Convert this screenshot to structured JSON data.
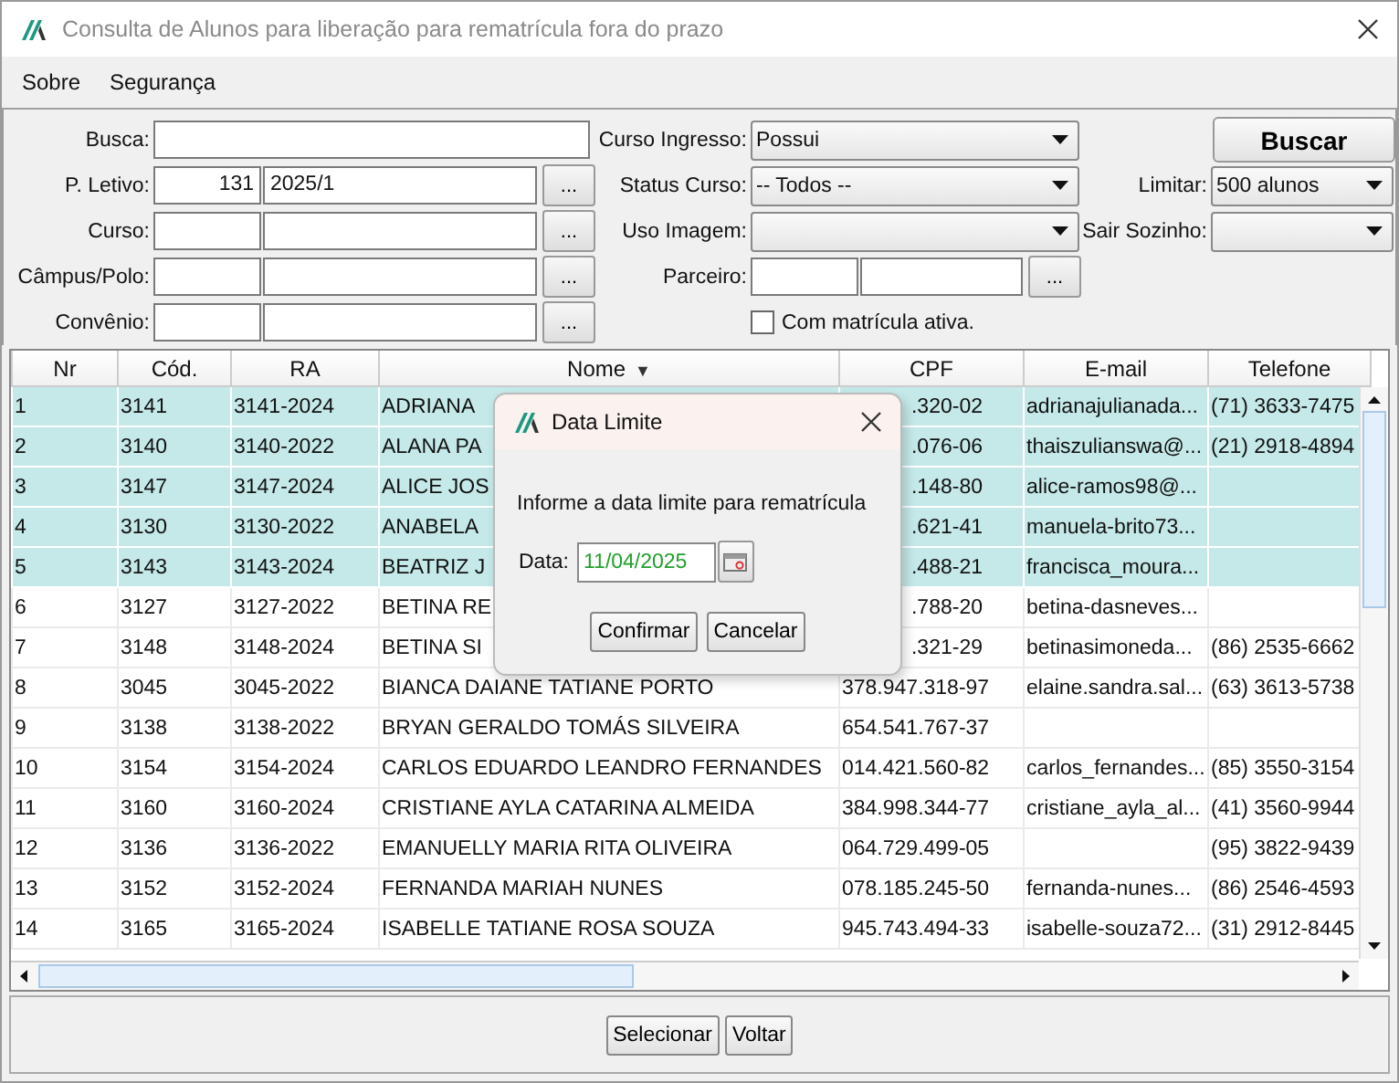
{
  "window": {
    "title": "Consulta de Alunos para liberação para rematrícula fora do prazo"
  },
  "menu": [
    {
      "label": "Sobre"
    },
    {
      "label": "Segurança"
    }
  ],
  "filters": {
    "left": [
      {
        "kind": "text",
        "label": "Busca:"
      },
      {
        "kind": "lookup",
        "label": "P. Letivo:",
        "code": "131",
        "value": "2025/1",
        "button": "..."
      },
      {
        "kind": "lookup",
        "label": "Curso:",
        "button": "..."
      },
      {
        "kind": "lookup",
        "label": "Câmpus/Polo:",
        "button": "..."
      },
      {
        "kind": "lookup",
        "label": "Convênio:",
        "button": "..."
      }
    ],
    "middle": [
      {
        "kind": "select",
        "label": "Curso Ingresso:",
        "value": "Possui"
      },
      {
        "kind": "select",
        "label": "Status Curso:",
        "value": "-- Todos --"
      },
      {
        "kind": "select",
        "label": "Uso Imagem:"
      },
      {
        "kind": "lookup",
        "label": "Parceiro:",
        "button": "..."
      },
      {
        "kind": "checkbox",
        "label": "Com matrícula ativa.",
        "checked": false
      }
    ],
    "right": [
      {
        "kind": "button",
        "label": "Buscar"
      },
      {
        "kind": "select",
        "label": "Limitar:",
        "value": "500 alunos"
      },
      {
        "kind": "select",
        "label": "Sair Sozinho:"
      }
    ]
  },
  "table": {
    "columns": [
      {
        "label": "Nr"
      },
      {
        "label": "Cód."
      },
      {
        "label": "RA"
      },
      {
        "label": "Nome",
        "sort_icon": "▼"
      },
      {
        "label": "CPF"
      },
      {
        "label": "E-mail"
      },
      {
        "label": "Telefone"
      }
    ],
    "rows": [
      {
        "selected": true,
        "covered": true,
        "cells": [
          "1",
          "3141",
          "3141-2024",
          "ADRIANA",
          ".320-02",
          "adrianajulianada...",
          "(71) 3633-7475"
        ]
      },
      {
        "selected": true,
        "covered": true,
        "cells": [
          "2",
          "3140",
          "3140-2022",
          "ALANA PA",
          ".076-06",
          "thaiszulianswa@...",
          "(21) 2918-4894"
        ]
      },
      {
        "selected": true,
        "covered": true,
        "cells": [
          "3",
          "3147",
          "3147-2024",
          "ALICE JOS",
          ".148-80",
          "alice-ramos98@...",
          ""
        ]
      },
      {
        "selected": true,
        "covered": true,
        "cells": [
          "4",
          "3130",
          "3130-2022",
          "ANABELA",
          ".621-41",
          "manuela-brito73...",
          ""
        ]
      },
      {
        "selected": true,
        "covered": true,
        "cells": [
          "5",
          "3143",
          "3143-2024",
          "BEATRIZ J",
          ".488-21",
          "francisca_moura...",
          ""
        ]
      },
      {
        "selected": false,
        "covered": true,
        "cells": [
          "6",
          "3127",
          "3127-2022",
          "BETINA RE",
          ".788-20",
          "betina-dasneves...",
          ""
        ]
      },
      {
        "selected": false,
        "covered": true,
        "cells": [
          "7",
          "3148",
          "3148-2024",
          "BETINA SI",
          ".321-29",
          "betinasimoneda...",
          "(86) 2535-6662"
        ]
      },
      {
        "selected": false,
        "cells": [
          "8",
          "3045",
          "3045-2022",
          "BIANCA DAIANE TATIANE PORTO",
          "378.947.318-97",
          "elaine.sandra.sal...",
          "(63) 3613-5738"
        ]
      },
      {
        "selected": false,
        "cells": [
          "9",
          "3138",
          "3138-2022",
          "BRYAN GERALDO TOMÁS SILVEIRA",
          "654.541.767-37",
          "",
          ""
        ]
      },
      {
        "selected": false,
        "cells": [
          "10",
          "3154",
          "3154-2024",
          "CARLOS EDUARDO LEANDRO FERNANDES",
          "014.421.560-82",
          "carlos_fernandes...",
          "(85) 3550-3154"
        ]
      },
      {
        "selected": false,
        "cells": [
          "11",
          "3160",
          "3160-2024",
          "CRISTIANE AYLA CATARINA ALMEIDA",
          "384.998.344-77",
          "cristiane_ayla_al...",
          "(41) 3560-9944"
        ]
      },
      {
        "selected": false,
        "cells": [
          "12",
          "3136",
          "3136-2022",
          "EMANUELLY MARIA RITA OLIVEIRA",
          "064.729.499-05",
          "",
          "(95) 3822-9439"
        ]
      },
      {
        "selected": false,
        "cells": [
          "13",
          "3152",
          "3152-2024",
          "FERNANDA MARIAH NUNES",
          "078.185.245-50",
          "fernanda-nunes...",
          "(86) 2546-4593"
        ]
      },
      {
        "selected": false,
        "cells": [
          "14",
          "3165",
          "3165-2024",
          "ISABELLE TATIANE ROSA SOUZA",
          "945.743.494-33",
          "isabelle-souza72...",
          "(31) 2912-8445"
        ]
      }
    ]
  },
  "buttons": [
    {
      "label": "Selecionar"
    },
    {
      "label": "Voltar"
    }
  ],
  "dialog": {
    "title": "Data Limite",
    "message": "Informe a data limite para rematrícula",
    "date_label": "Data:",
    "date_value": "11/04/2025",
    "buttons": [
      {
        "label": "Confirmar"
      },
      {
        "label": "Cancelar"
      }
    ]
  }
}
